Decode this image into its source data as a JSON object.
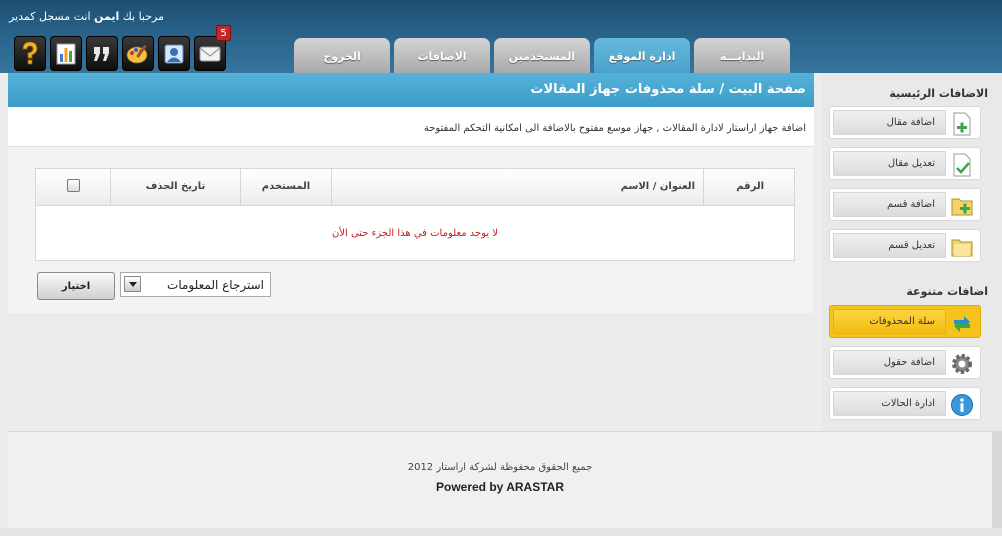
{
  "header": {
    "welcome_prefix": "مرحبا بك",
    "username": "ايمن",
    "welcome_suffix": "انت مسجل كمدير",
    "notification_count": "5",
    "tabs": [
      {
        "label": "البدايـــة",
        "active": false
      },
      {
        "label": "ادارة الموقع",
        "active": true
      },
      {
        "label": "المستخدمين",
        "active": false
      },
      {
        "label": "الاضافات",
        "active": false
      },
      {
        "label": "الخروج",
        "active": false
      }
    ],
    "icons": [
      "help-icon",
      "stats-icon",
      "quotes-icon",
      "palette-icon",
      "contacts-icon",
      "mail-icon"
    ]
  },
  "main": {
    "title": "صفحة البيت / سلة محذوفات جهاز المقالات",
    "description": "اضافة جهاز اراستار لادارة المقالات , جهاز موسع مفتوح بالاضافة الى امكانية التحكم المفتوحة",
    "table": {
      "columns": {
        "number": "الرقم",
        "title": "العنوان / الاسم",
        "user": "المستخدم",
        "delete_date": "تاريخ الحذف"
      },
      "empty_message": "لا يوجد معلومات في هذا الجزء حتى الأن"
    },
    "action_select": "استرجاع المعلومات",
    "action_button": "اختيار"
  },
  "sidebar": {
    "main_heading": "الاضافات الرئيسية",
    "main_items": [
      {
        "label": "اضافة مقال",
        "icon": "add-article-icon"
      },
      {
        "label": "تعديل مقال",
        "icon": "edit-article-icon"
      },
      {
        "label": "اضافة قسم",
        "icon": "add-section-icon"
      },
      {
        "label": "تعديل قسم",
        "icon": "edit-section-icon"
      }
    ],
    "misc_heading": "اضافات متنوعة",
    "misc_items": [
      {
        "label": "سلة المحذوفات",
        "icon": "recycle-icon",
        "active": true
      },
      {
        "label": "اضافة حقول",
        "icon": "gear-icon"
      },
      {
        "label": "ادارة الحالات",
        "icon": "info-icon"
      }
    ]
  },
  "footer": {
    "copyright": "جميع الحقوق محفوظة لشركة اراستار 2012",
    "powered": "Powered by ARASTAR"
  },
  "colors": {
    "header": "#2c6890",
    "accent": "#4aa2cb",
    "active_item": "#f6c21c",
    "empty_text": "#c02020"
  }
}
